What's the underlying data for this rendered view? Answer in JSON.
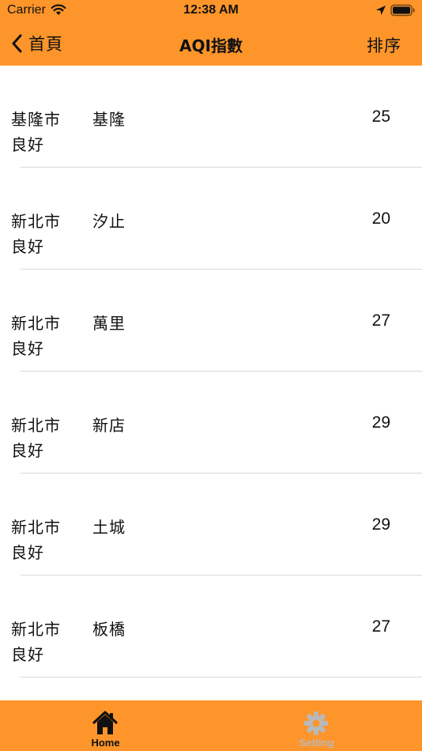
{
  "theme": {
    "accent": "#fd952a",
    "inactive_tab": "#b9b9b9",
    "separator": "#d9d9d9"
  },
  "status_bar": {
    "carrier": "Carrier",
    "time": "12:38 AM",
    "icons": [
      "wifi-icon",
      "location-icon",
      "battery-icon"
    ]
  },
  "nav": {
    "back_label": "首頁",
    "title": "AQI指數",
    "sort_label": "排序"
  },
  "list": {
    "items": [
      {
        "county": "基隆市",
        "status": "良好",
        "site": "基隆",
        "aqi": "25"
      },
      {
        "county": "新北市",
        "status": "良好",
        "site": "汐止",
        "aqi": "20"
      },
      {
        "county": "新北市",
        "status": "良好",
        "site": "萬里",
        "aqi": "27"
      },
      {
        "county": "新北市",
        "status": "良好",
        "site": "新店",
        "aqi": "29"
      },
      {
        "county": "新北市",
        "status": "良好",
        "site": "土城",
        "aqi": "29"
      },
      {
        "county": "新北市",
        "status": "良好",
        "site": "板橋",
        "aqi": "27"
      }
    ]
  },
  "tab_bar": {
    "tabs": [
      {
        "label": "Home",
        "icon": "home-icon",
        "selected": true
      },
      {
        "label": "Setting",
        "icon": "gear-icon",
        "selected": false
      }
    ]
  }
}
